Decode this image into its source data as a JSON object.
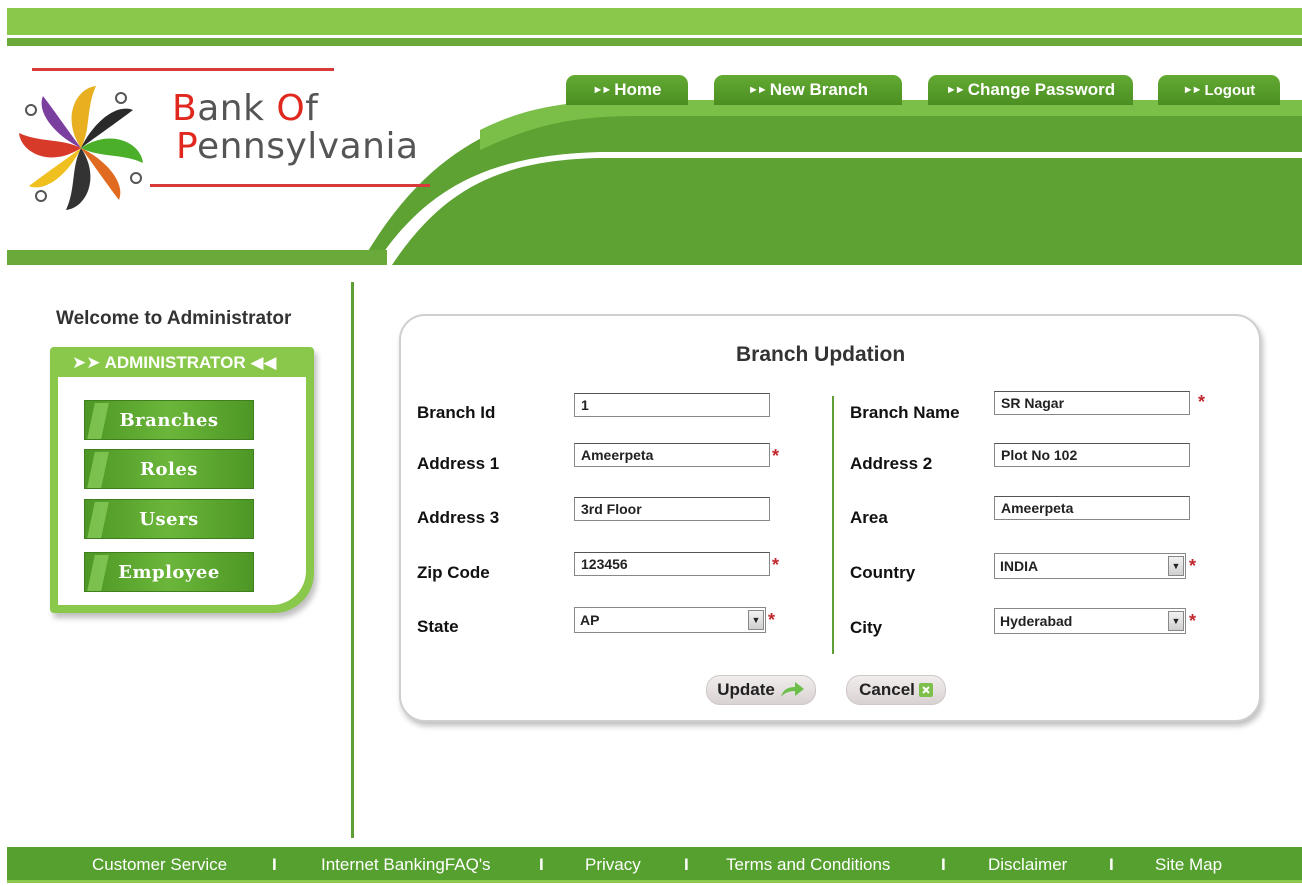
{
  "brand": {
    "line1_a": "B",
    "line1_b": "ank ",
    "line1_c": "O",
    "line1_d": "f",
    "line2_a": "P",
    "line2_b": "ennsylvania"
  },
  "nav": {
    "home": "Home",
    "new_branch": "New Branch",
    "change_password": "Change Password",
    "logout": "Logout"
  },
  "sidebar": {
    "welcome": "Welcome to Administrator",
    "title": "ADMINISTRATOR",
    "items": [
      "Branches",
      "Roles",
      "Users",
      "Employee"
    ]
  },
  "form": {
    "title": "Branch Updation",
    "branch_id_label": "Branch Id",
    "branch_id_value": "1",
    "branch_name_label": "Branch Name",
    "branch_name_value": "SR Nagar",
    "address1_label": "Address 1",
    "address1_value": "Ameerpeta",
    "address2_label": "Address 2",
    "address2_value": "Plot No 102",
    "address3_label": "Address 3",
    "address3_value": "3rd Floor",
    "area_label": "Area",
    "area_value": "Ameerpeta",
    "zip_label": "Zip Code",
    "zip_value": "123456",
    "country_label": "Country",
    "country_value": "INDIA",
    "state_label": "State",
    "state_value": "AP",
    "city_label": "City",
    "city_value": "Hyderabad",
    "required_mark": "*",
    "update_label": "Update",
    "cancel_label": "Cancel"
  },
  "footer": {
    "links": [
      "Customer Service",
      "Internet BankingFAQ's",
      "Privacy",
      "Terms and Conditions",
      "Disclaimer",
      "Site Map"
    ],
    "separator": "I"
  },
  "colors": {
    "brand_green": "#5f9f35",
    "light_green": "#8ac84b",
    "brand_red": "#e0281f"
  }
}
